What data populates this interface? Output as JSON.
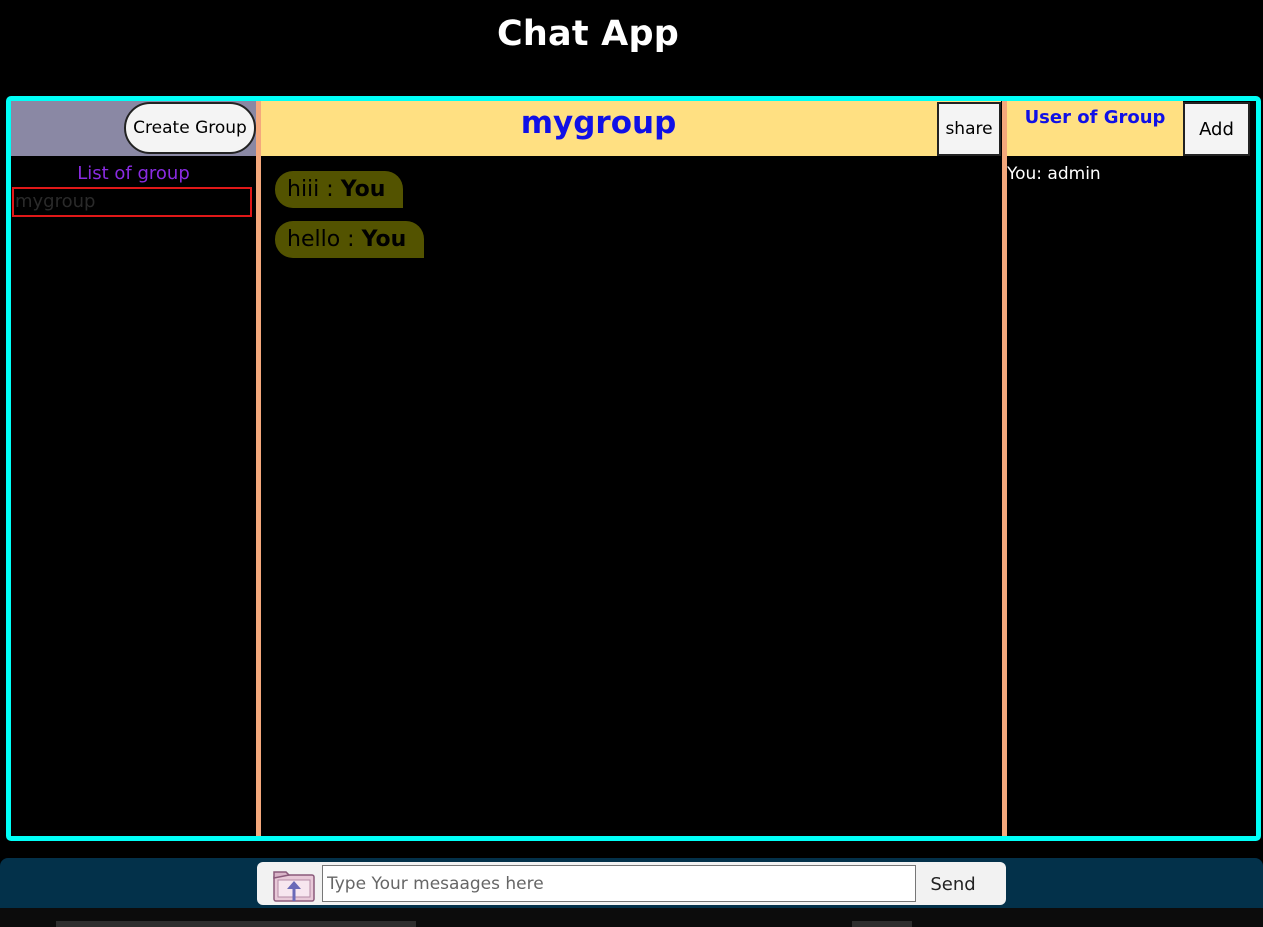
{
  "app": {
    "title": "Chat App"
  },
  "sidebar": {
    "create_label": "Create Group",
    "list_title": "List of group",
    "groups": [
      "mygroup"
    ]
  },
  "chat": {
    "group_name": "mygroup",
    "share_label": "share",
    "messages": [
      {
        "text": "hiii : ",
        "sender": "You"
      },
      {
        "text": "hello : ",
        "sender": "You"
      }
    ]
  },
  "members": {
    "title": "User of Group",
    "add_label": "Add",
    "list": [
      "You: admin"
    ]
  },
  "composer": {
    "placeholder": "Type Your mesaages here",
    "send_label": "Send",
    "upload_icon": "file-upload-icon"
  },
  "colors": {
    "frame_border": "#00fff7",
    "header_yellow": "#ffe082",
    "sidebar_header": "#8a88a4",
    "divider": "#f4a87c",
    "message_bubble": "#535300",
    "title_blue": "#1010e6",
    "list_title": "#8a2be2",
    "selected_border": "#e01818",
    "bottom_bar": "#03314a"
  }
}
